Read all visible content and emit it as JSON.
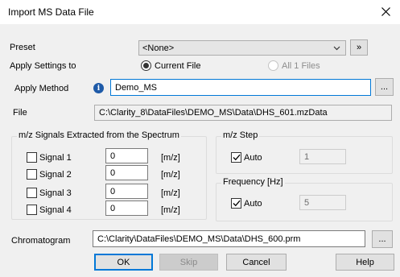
{
  "window": {
    "title": "Import MS Data File"
  },
  "preset": {
    "label": "Preset",
    "value": "<None>",
    "more_label": "»"
  },
  "apply_settings": {
    "label": "Apply Settings to",
    "current_file_label": "Current File",
    "all_files_label": "All 1 Files",
    "selected": "current_file"
  },
  "apply_method": {
    "label": "Apply Method",
    "value": "Demo_MS",
    "browse_label": "..."
  },
  "file": {
    "label": "File",
    "value": "C:\\Clarity_8\\DataFiles\\DEMO_MS\\Data\\DHS_601.mzData"
  },
  "signals_group": {
    "title": "m/z Signals Extracted from the Spectrum",
    "signals": [
      {
        "label": "Signal 1",
        "checked": false,
        "value": "0",
        "unit": "[m/z]"
      },
      {
        "label": "Signal 2",
        "checked": false,
        "value": "0",
        "unit": "[m/z]"
      },
      {
        "label": "Signal 3",
        "checked": false,
        "value": "0",
        "unit": "[m/z]"
      },
      {
        "label": "Signal 4",
        "checked": false,
        "value": "0",
        "unit": "[m/z]"
      }
    ]
  },
  "mz_step": {
    "title": "m/z Step",
    "auto_label": "Auto",
    "auto_checked": true,
    "value": "1"
  },
  "frequency": {
    "title": "Frequency [Hz]",
    "auto_label": "Auto",
    "auto_checked": true,
    "value": "5"
  },
  "chromatogram": {
    "label": "Chromatogram",
    "value": "C:\\Clarity\\DataFiles\\DEMO_MS\\Data\\DHS_600.prm",
    "browse_label": "..."
  },
  "buttons": {
    "ok": "OK",
    "skip": "Skip",
    "cancel": "Cancel",
    "help": "Help"
  },
  "colors": {
    "accent": "#0078d7",
    "dialog_bg": "#f0f0f0",
    "info_icon": "#1e5aa8"
  },
  "icons": {
    "close": "close-icon",
    "info": "info-icon",
    "dropdown": "chevron-down-icon",
    "checkmark": "checkmark-icon"
  }
}
